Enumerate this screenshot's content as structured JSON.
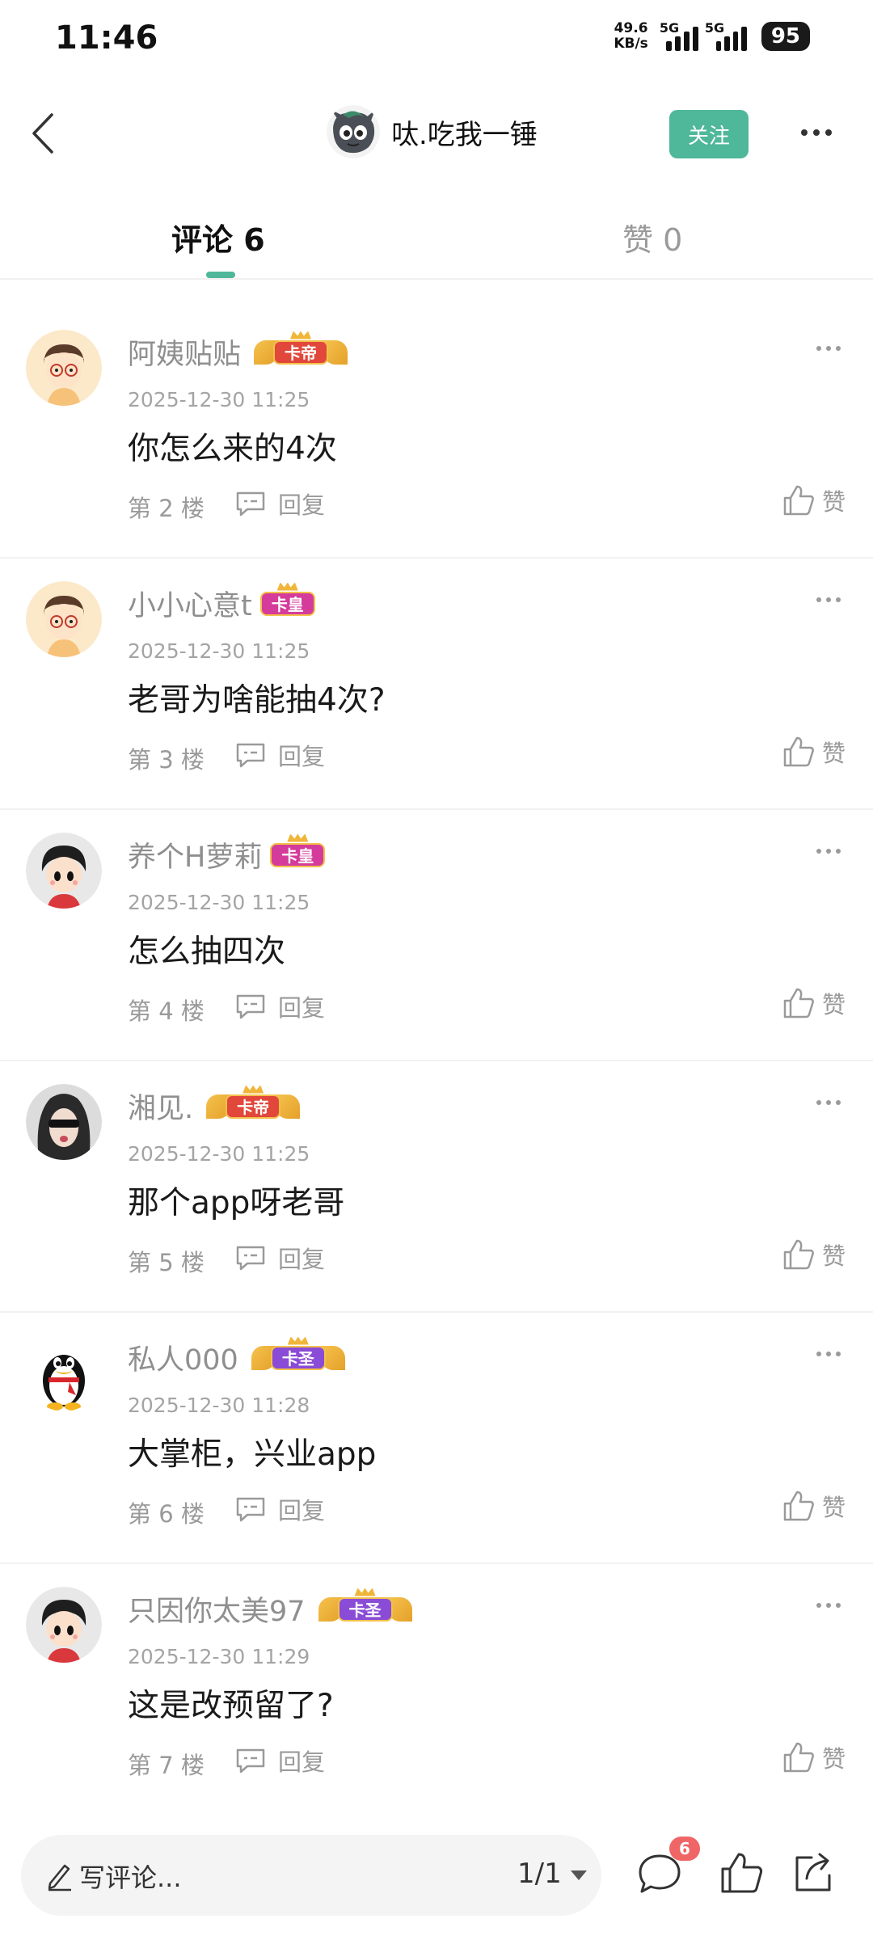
{
  "status_bar": {
    "time": "11:46",
    "net_speed_value": "49.6",
    "net_speed_unit": "KB/s",
    "signal_1_label": "5G",
    "signal_2_label": "5G",
    "battery": "95"
  },
  "header": {
    "username": "呔.吃我一锤",
    "follow_label": "关注"
  },
  "tabs": {
    "comments_label": "评论 6",
    "likes_label": "赞 0"
  },
  "comments": [
    {
      "name": "阿姨贴贴",
      "badge": "卡帝",
      "badge_color": "#e2473b",
      "time": "2025-12-30 11:25",
      "text": "你怎么来的4次",
      "floor": "第 2 楼",
      "reply": "回复",
      "like": "赞"
    },
    {
      "name": "小小心意t",
      "badge": "卡皇",
      "badge_color": "#d43b9b",
      "time": "2025-12-30 11:25",
      "text": "老哥为啥能抽4次?",
      "floor": "第 3 楼",
      "reply": "回复",
      "like": "赞"
    },
    {
      "name": "养个H萝莉",
      "badge": "卡皇",
      "badge_color": "#d43b9b",
      "time": "2025-12-30 11:25",
      "text": "怎么抽四次",
      "floor": "第 4 楼",
      "reply": "回复",
      "like": "赞"
    },
    {
      "name": "湘见.",
      "badge": "卡帝",
      "badge_color": "#e2473b",
      "time": "2025-12-30 11:25",
      "text": "那个app呀老哥",
      "floor": "第 5 楼",
      "reply": "回复",
      "like": "赞"
    },
    {
      "name": "私人000",
      "badge": "卡圣",
      "badge_color": "#8a4bd6",
      "time": "2025-12-30 11:28",
      "text": "大掌柜，兴业app",
      "floor": "第 6 楼",
      "reply": "回复",
      "like": "赞"
    },
    {
      "name": "只因你太美97",
      "badge": "卡圣",
      "badge_color": "#8a4bd6",
      "time": "2025-12-30 11:29",
      "text": "这是改预留了?",
      "floor": "第 7 楼",
      "reply": "回复",
      "like": "赞"
    }
  ],
  "bottom_bar": {
    "input_placeholder": "写评论...",
    "page_indicator": "1/1",
    "comment_count": "6"
  },
  "colors": {
    "accent": "#4fb79a",
    "badge_count": "#f06565"
  },
  "icons": {
    "back": "back-chevron-icon",
    "more": "more-dots-icon",
    "reply": "reply-bubble-icon",
    "like": "thumbs-up-icon",
    "pen": "pen-icon",
    "comment": "comment-bubble-icon",
    "share": "share-icon"
  }
}
